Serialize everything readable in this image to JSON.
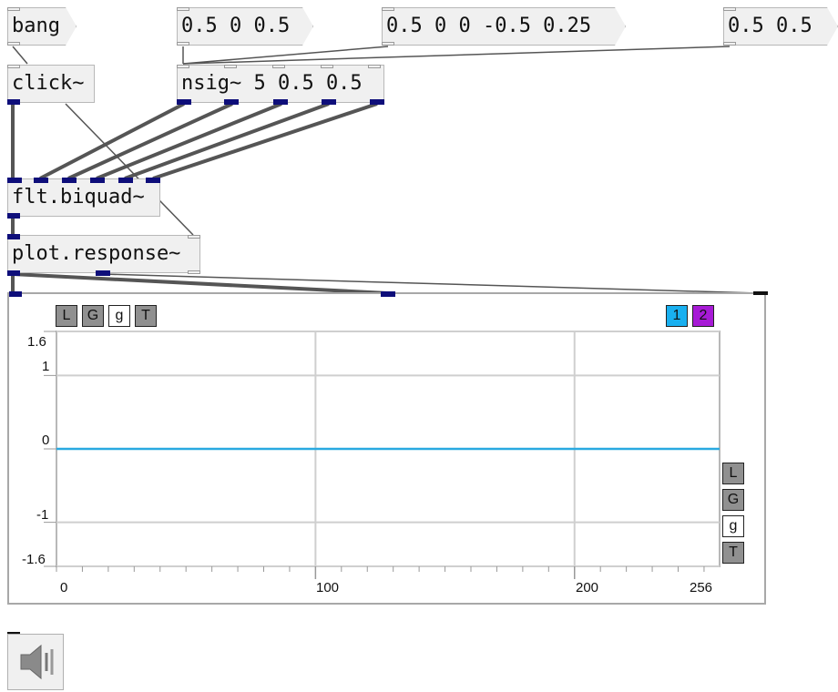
{
  "patch": {
    "messages": {
      "bang": "bang",
      "msg1": "0.5 0 0.5",
      "msg2": "0.5 0 0 -0.5 0.25",
      "msg3": "0.5 0.5"
    },
    "objects": {
      "click": "click~",
      "nsig": "nsig~ 5 0.5 0.5",
      "biquad": "flt.biquad~",
      "response": "plot.response~"
    },
    "colors": {
      "signal_port": "#0e0e7a",
      "signal_cord": "#555555",
      "control_cord": "#555555",
      "plot_line": "#29a9e0"
    }
  },
  "plot": {
    "toolbar_top": [
      "L",
      "G",
      "g",
      "T"
    ],
    "toolbar_side": [
      "L",
      "G",
      "g",
      "T"
    ],
    "series_buttons": [
      {
        "label": "1",
        "color": "#19b0f0"
      },
      {
        "label": "2",
        "color": "#a71ad6"
      }
    ],
    "y_tick_labels": [
      "1.6",
      "1",
      "0",
      "-1",
      "-1.6"
    ],
    "x_tick_labels": [
      "0",
      "100",
      "200",
      "256"
    ]
  },
  "chart_data": {
    "type": "line",
    "x_range": [
      0,
      256
    ],
    "y_range": [
      -1.6,
      1.6
    ],
    "y_ticks": [
      1.6,
      1,
      0,
      -1,
      -1.6
    ],
    "x_ticks": [
      0,
      100,
      200,
      256
    ],
    "grid": true,
    "series": [
      {
        "x": [
          0,
          256
        ],
        "y": [
          0,
          0
        ],
        "color": "#29a9e0"
      }
    ]
  },
  "speaker": {
    "icon": "speaker-icon"
  }
}
